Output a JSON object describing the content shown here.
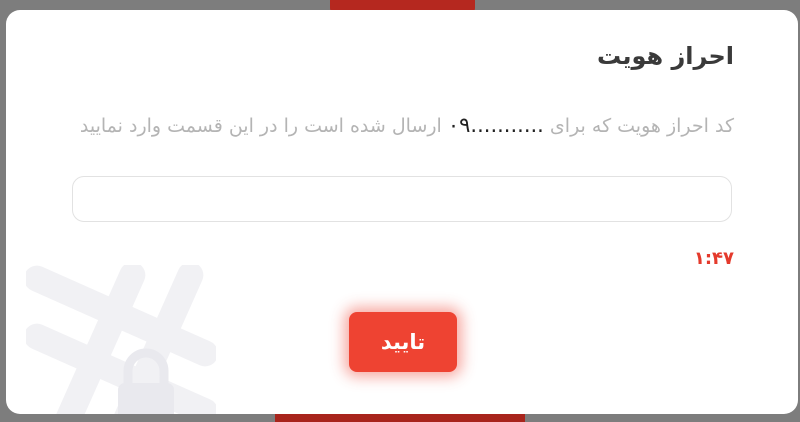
{
  "modal": {
    "title": "احراز هویت",
    "description_before": "کد احراز هویت که برای",
    "phone_number": "۰۹...........",
    "description_after": "ارسال شده است را در این قسمت وارد نمایید",
    "code_input_value": "",
    "code_input_placeholder": "",
    "timer": "۱:۴۷",
    "confirm_label": "تایید",
    "watermark_icon": "hashtag-lock-icon"
  },
  "colors": {
    "accent": "#ee4332",
    "timer": "#e43a2c",
    "title": "#3a3a3a",
    "description": "#b4b4b4"
  }
}
